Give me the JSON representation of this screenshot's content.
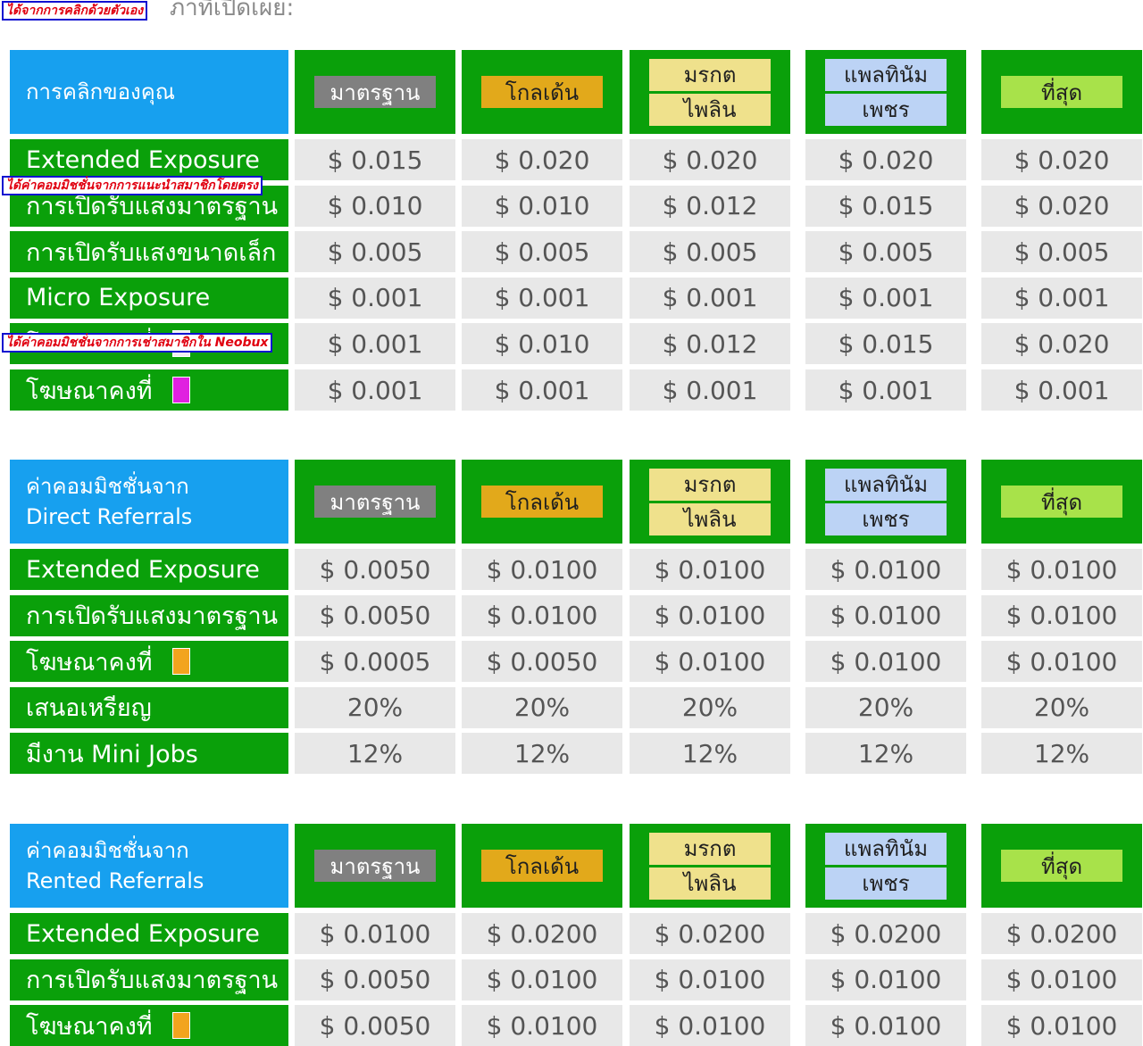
{
  "header_text": "ภาที่เปิดเผย:",
  "notes": {
    "own_clicks": "ได้จากการคลิกด้วยตัวเอง",
    "direct_referrals": "ได้ค่าคอมมิชชั่นจากการแนะนำสมาชิกโดยตรง",
    "rented_referrals_prefix": "ได้ค่าคอมมิชชั่นจากการเช่าสมาชิกใน",
    "rented_referrals_brand": "Neobux"
  },
  "tiers": {
    "standard": "มาตรฐาน",
    "golden": "โกลเด้น",
    "emerald": "มรกต",
    "sapphire": "ไพลิน",
    "platinum": "แพลทินัม",
    "diamond": "เพชร",
    "ultimate": "ที่สุด"
  },
  "colors": {
    "green": "#0aa00a",
    "blue": "#17a0ef",
    "magenta_swatch": "#e020e0",
    "orange_swatch": "#f2a41e"
  },
  "sections": [
    {
      "title_line1": "การคลิกของคุณ",
      "title_line2": "",
      "rows": [
        {
          "label": "Extended Exposure",
          "swatch": "",
          "values": [
            "$ 0.015",
            "$ 0.020",
            "$ 0.020",
            "$ 0.020",
            "$ 0.020"
          ]
        },
        {
          "label": "การเปิดรับแสงมาตรฐาน",
          "swatch": "",
          "values": [
            "$ 0.010",
            "$ 0.010",
            "$ 0.012",
            "$ 0.015",
            "$ 0.020"
          ]
        },
        {
          "label": "การเปิดรับแสงขนาดเล็ก",
          "swatch": "",
          "values": [
            "$ 0.005",
            "$ 0.005",
            "$ 0.005",
            "$ 0.005",
            "$ 0.005"
          ]
        },
        {
          "label": "Micro Exposure",
          "swatch": "",
          "values": [
            "$ 0.001",
            "$ 0.001",
            "$ 0.001",
            "$ 0.001",
            "$ 0.001"
          ]
        },
        {
          "label": "โฆษณาคงที่",
          "swatch": "#f0f0f0",
          "values": [
            "$ 0.001",
            "$ 0.010",
            "$ 0.012",
            "$ 0.015",
            "$ 0.020"
          ]
        },
        {
          "label": "โฆษณาคงที่",
          "swatch": "#e020e0",
          "values": [
            "$ 0.001",
            "$ 0.001",
            "$ 0.001",
            "$ 0.001",
            "$ 0.001"
          ]
        }
      ]
    },
    {
      "title_line1": "ค่าคอมมิชชั่นจาก",
      "title_line2": "Direct Referrals",
      "rows": [
        {
          "label": "Extended Exposure",
          "swatch": "",
          "values": [
            "$ 0.0050",
            "$ 0.0100",
            "$ 0.0100",
            "$ 0.0100",
            "$ 0.0100"
          ]
        },
        {
          "label": "การเปิดรับแสงมาตรฐาน",
          "swatch": "",
          "values": [
            "$ 0.0050",
            "$ 0.0100",
            "$ 0.0100",
            "$ 0.0100",
            "$ 0.0100"
          ]
        },
        {
          "label": "โฆษณาคงที่",
          "swatch": "#f2a41e",
          "values": [
            "$ 0.0005",
            "$ 0.0050",
            "$ 0.0100",
            "$ 0.0100",
            "$ 0.0100"
          ]
        },
        {
          "label": "เสนอเหรียญ",
          "swatch": "",
          "values": [
            "20%",
            "20%",
            "20%",
            "20%",
            "20%"
          ]
        },
        {
          "label": "มีงาน Mini Jobs",
          "swatch": "",
          "values": [
            "12%",
            "12%",
            "12%",
            "12%",
            "12%"
          ]
        }
      ]
    },
    {
      "title_line1": "ค่าคอมมิชชั่นจาก",
      "title_line2": "Rented Referrals",
      "rows": [
        {
          "label": "Extended Exposure",
          "swatch": "",
          "values": [
            "$ 0.0100",
            "$ 0.0200",
            "$ 0.0200",
            "$ 0.0200",
            "$ 0.0200"
          ]
        },
        {
          "label": "การเปิดรับแสงมาตรฐาน",
          "swatch": "",
          "values": [
            "$ 0.0050",
            "$ 0.0100",
            "$ 0.0100",
            "$ 0.0100",
            "$ 0.0100"
          ]
        },
        {
          "label": "โฆษณาคงที่",
          "swatch": "#f2a41e",
          "values": [
            "$ 0.0050",
            "$ 0.0100",
            "$ 0.0100",
            "$ 0.0100",
            "$ 0.0100"
          ]
        }
      ]
    }
  ]
}
